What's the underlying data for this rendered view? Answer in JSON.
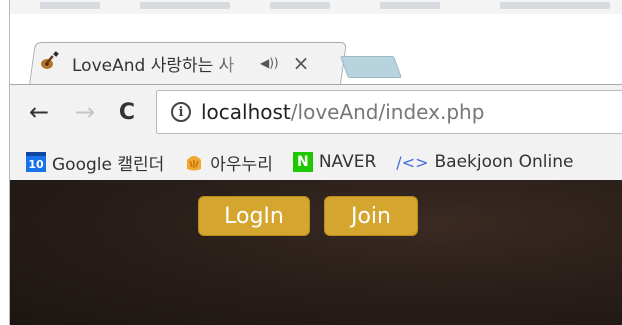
{
  "browser": {
    "tab": {
      "title": "LoveAnd 사랑하는 사",
      "speaker_symbol": "◀))",
      "close_symbol": "×",
      "favicon": "guitar-icon"
    },
    "toolbar": {
      "back_symbol": "←",
      "forward_symbol": "→",
      "reload_symbol": "C",
      "info_symbol": "i",
      "url_host": "localhost",
      "url_path": "/loveAnd/index.php"
    },
    "bookmarks": [
      {
        "icon": "calendar-icon",
        "icon_text": "10",
        "label": "Google 캘린더"
      },
      {
        "icon": "aunuri-icon",
        "icon_text": "",
        "label": "아우누리"
      },
      {
        "icon": "naver-icon",
        "icon_text": "N",
        "label": "NAVER"
      },
      {
        "icon": "code-icon",
        "icon_text": "/<>",
        "label": "Baekjoon Online"
      }
    ]
  },
  "page": {
    "login_label": "LogIn",
    "join_label": "Join"
  },
  "colors": {
    "button_gold": "#d4a52f",
    "content_bg": "#2a1f1a",
    "chrome_gray": "#f2f2f2",
    "naver_green": "#1ec800"
  }
}
